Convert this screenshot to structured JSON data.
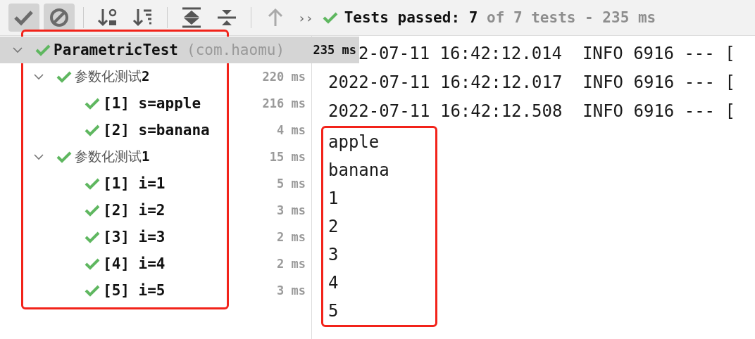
{
  "toolbar": {
    "buttons": [
      {
        "kind": "passed",
        "selected": true
      },
      {
        "kind": "ignored",
        "selected": true
      },
      {
        "kind": "sort-alpha",
        "selected": false
      },
      {
        "kind": "sort-duration",
        "selected": false
      },
      {
        "kind": "expand-all",
        "selected": false
      },
      {
        "kind": "collapse-all",
        "selected": false
      },
      {
        "kind": "previous",
        "selected": false,
        "disabled": true
      }
    ],
    "more": "››",
    "status": "**Tests passed: 7** of 7 tests - 235 ms",
    "status_passed": true
  },
  "tree": {
    "highlight": true,
    "items": [
      {
        "label": "ParametricTest",
        "package": "(com.haomu)",
        "duration": "235 ms",
        "passed": true,
        "expanded": true,
        "selected": true,
        "children": [
          {
            "label": "参数化测试**2**",
            "duration": "220 ms",
            "passed": true,
            "expanded": true,
            "selected": false,
            "children": [
              {
                "label": "[1] s=apple",
                "duration": "216 ms",
                "passed": true,
                "selected": false
              },
              {
                "label": "[2] s=banana",
                "duration": "4 ms",
                "passed": true,
                "selected": false
              }
            ]
          },
          {
            "label": "参数化测试**1**",
            "duration": "15 ms",
            "passed": true,
            "expanded": true,
            "selected": false,
            "children": [
              {
                "label": "[1] i=1",
                "duration": "5 ms",
                "passed": true,
                "selected": false
              },
              {
                "label": "[2] i=2",
                "duration": "3 ms",
                "passed": true,
                "selected": false
              },
              {
                "label": "[3] i=3",
                "duration": "2 ms",
                "passed": true,
                "selected": false
              },
              {
                "label": "[4] i=4",
                "duration": "2 ms",
                "passed": true,
                "selected": false
              },
              {
                "label": "[5] i=5",
                "duration": "3 ms",
                "passed": true,
                "selected": false
              }
            ]
          }
        ]
      }
    ]
  },
  "console": {
    "lines": [
      "2-07-11 16:42:12.014  INFO 6916 --- [",
      "2022-07-11 16:42:12.017  INFO 6916 --- [",
      "2022-07-11 16:42:12.508  INFO 6916 --- ["
    ],
    "output": [
      "apple",
      "banana",
      "1",
      "2",
      "3",
      "4",
      "5"
    ],
    "output_highlight": true
  }
}
